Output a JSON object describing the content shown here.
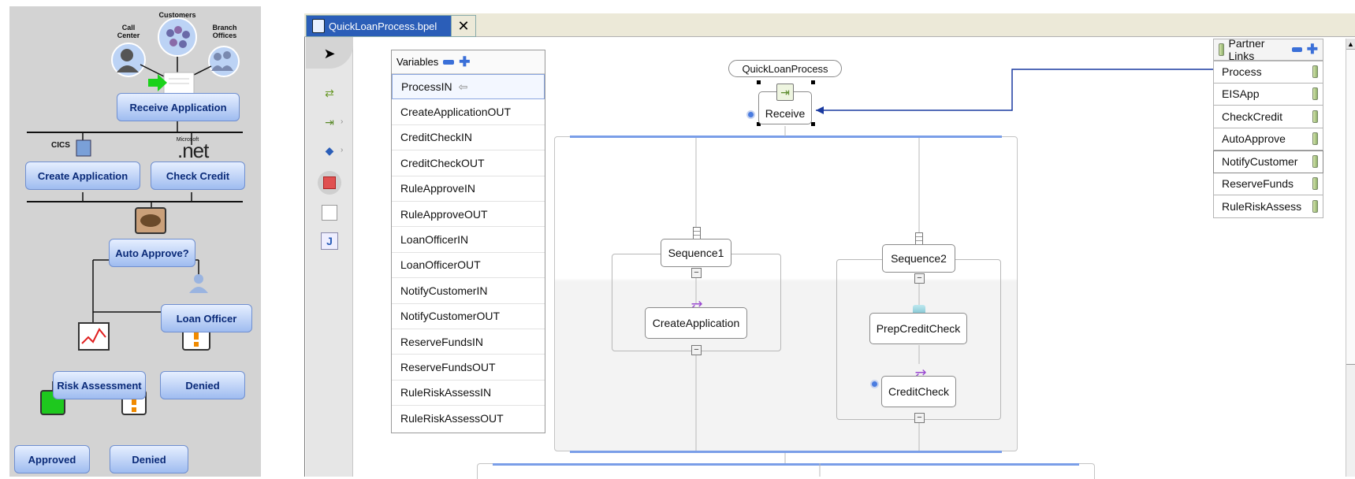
{
  "flow": {
    "sources": {
      "call_center": "Call\nCenter",
      "customers": "Customers",
      "branch_offices": "Branch\nOffices"
    },
    "receive": "Receive Application",
    "cics": "CICS",
    "microsoft": "Microsoft",
    "net": ".net",
    "create": "Create Application",
    "check": "Check Credit",
    "auto": "Auto Approve?",
    "officer": "Loan Officer",
    "risk": "Risk Assessment",
    "denied1": "Denied",
    "approved": "Approved",
    "denied2": "Denied"
  },
  "editor": {
    "tab_title": "QuickLoanProcess.bpel",
    "close_label": "✕",
    "variables_title": "Variables",
    "variables": [
      "ProcessIN",
      "CreateApplicationOUT",
      "CreditCheckIN",
      "CreditCheckOUT",
      "RuleApproveIN",
      "RuleApproveOUT",
      "LoanOfficerIN",
      "LoanOfficerOUT",
      "NotifyCustomerIN",
      "NotifyCustomerOUT",
      "ReserveFundsIN",
      "ReserveFundsOUT",
      "RuleRiskAssessIN",
      "RuleRiskAssessOUT"
    ],
    "process_name": "QuickLoanProcess",
    "receive": "Receive",
    "sequence1": "Sequence1",
    "sequence2": "Sequence2",
    "create_application": "CreateApplication",
    "prep_credit_check": "PrepCreditCheck",
    "credit_check": "CreditCheck",
    "partner_links_title": "Partner Links",
    "partner_links": [
      "Process",
      "EISApp",
      "CheckCredit",
      "AutoApprove",
      "NotifyCustomer",
      "ReserveFunds",
      "RuleRiskAssess"
    ]
  },
  "colors": {
    "accent": "#2b5eb8",
    "button": "#9fbcf0",
    "connector": "#1a3aa0"
  }
}
